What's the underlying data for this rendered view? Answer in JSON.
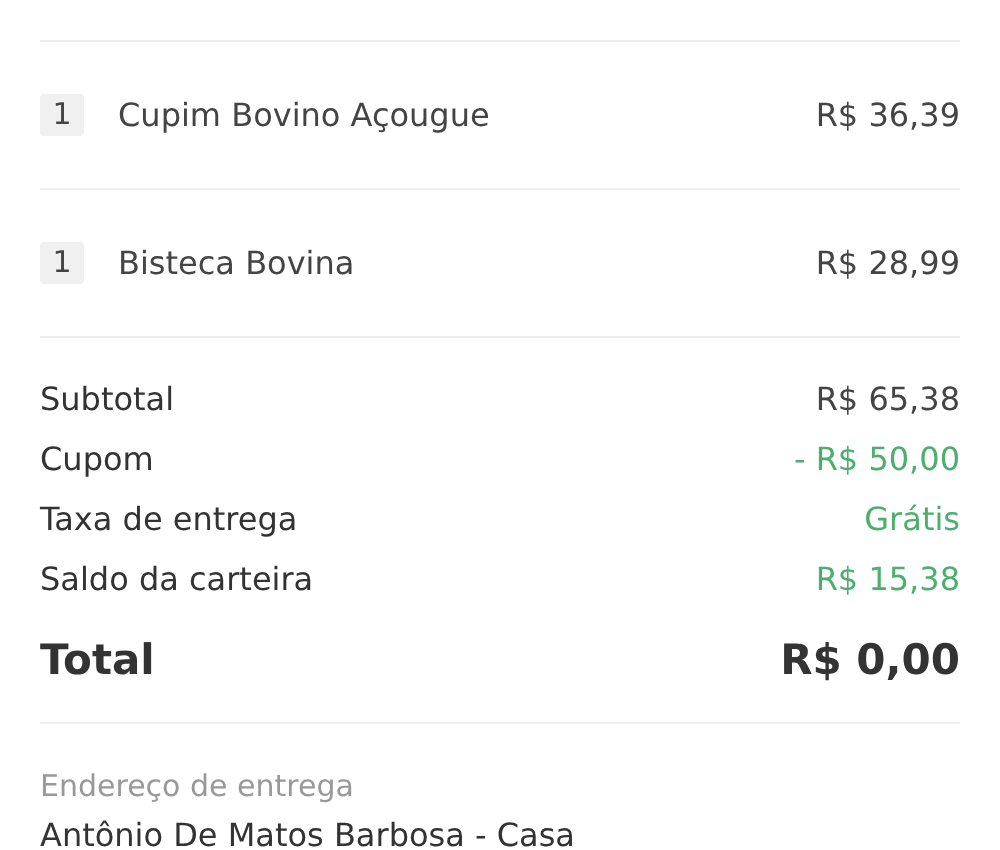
{
  "items": [
    {
      "quantity": "1",
      "name": "Cupim Bovino Açougue",
      "price": "R$ 36,39"
    },
    {
      "quantity": "1",
      "name": "Bisteca Bovina",
      "price": "R$ 28,99"
    }
  ],
  "summary": [
    {
      "label": "Subtotal",
      "value": "R$ 65,38",
      "highlight": false
    },
    {
      "label": "Cupom",
      "value": "- R$ 50,00",
      "highlight": true
    },
    {
      "label": "Taxa de entrega",
      "value": "Grátis",
      "highlight": true
    },
    {
      "label": "Saldo da carteira",
      "value": "R$ 15,38",
      "highlight": true
    }
  ],
  "total": {
    "label": "Total",
    "value": "R$ 0,00"
  },
  "delivery": {
    "heading": "Endereço de entrega",
    "address": "Antônio De Matos Barbosa - Casa"
  }
}
